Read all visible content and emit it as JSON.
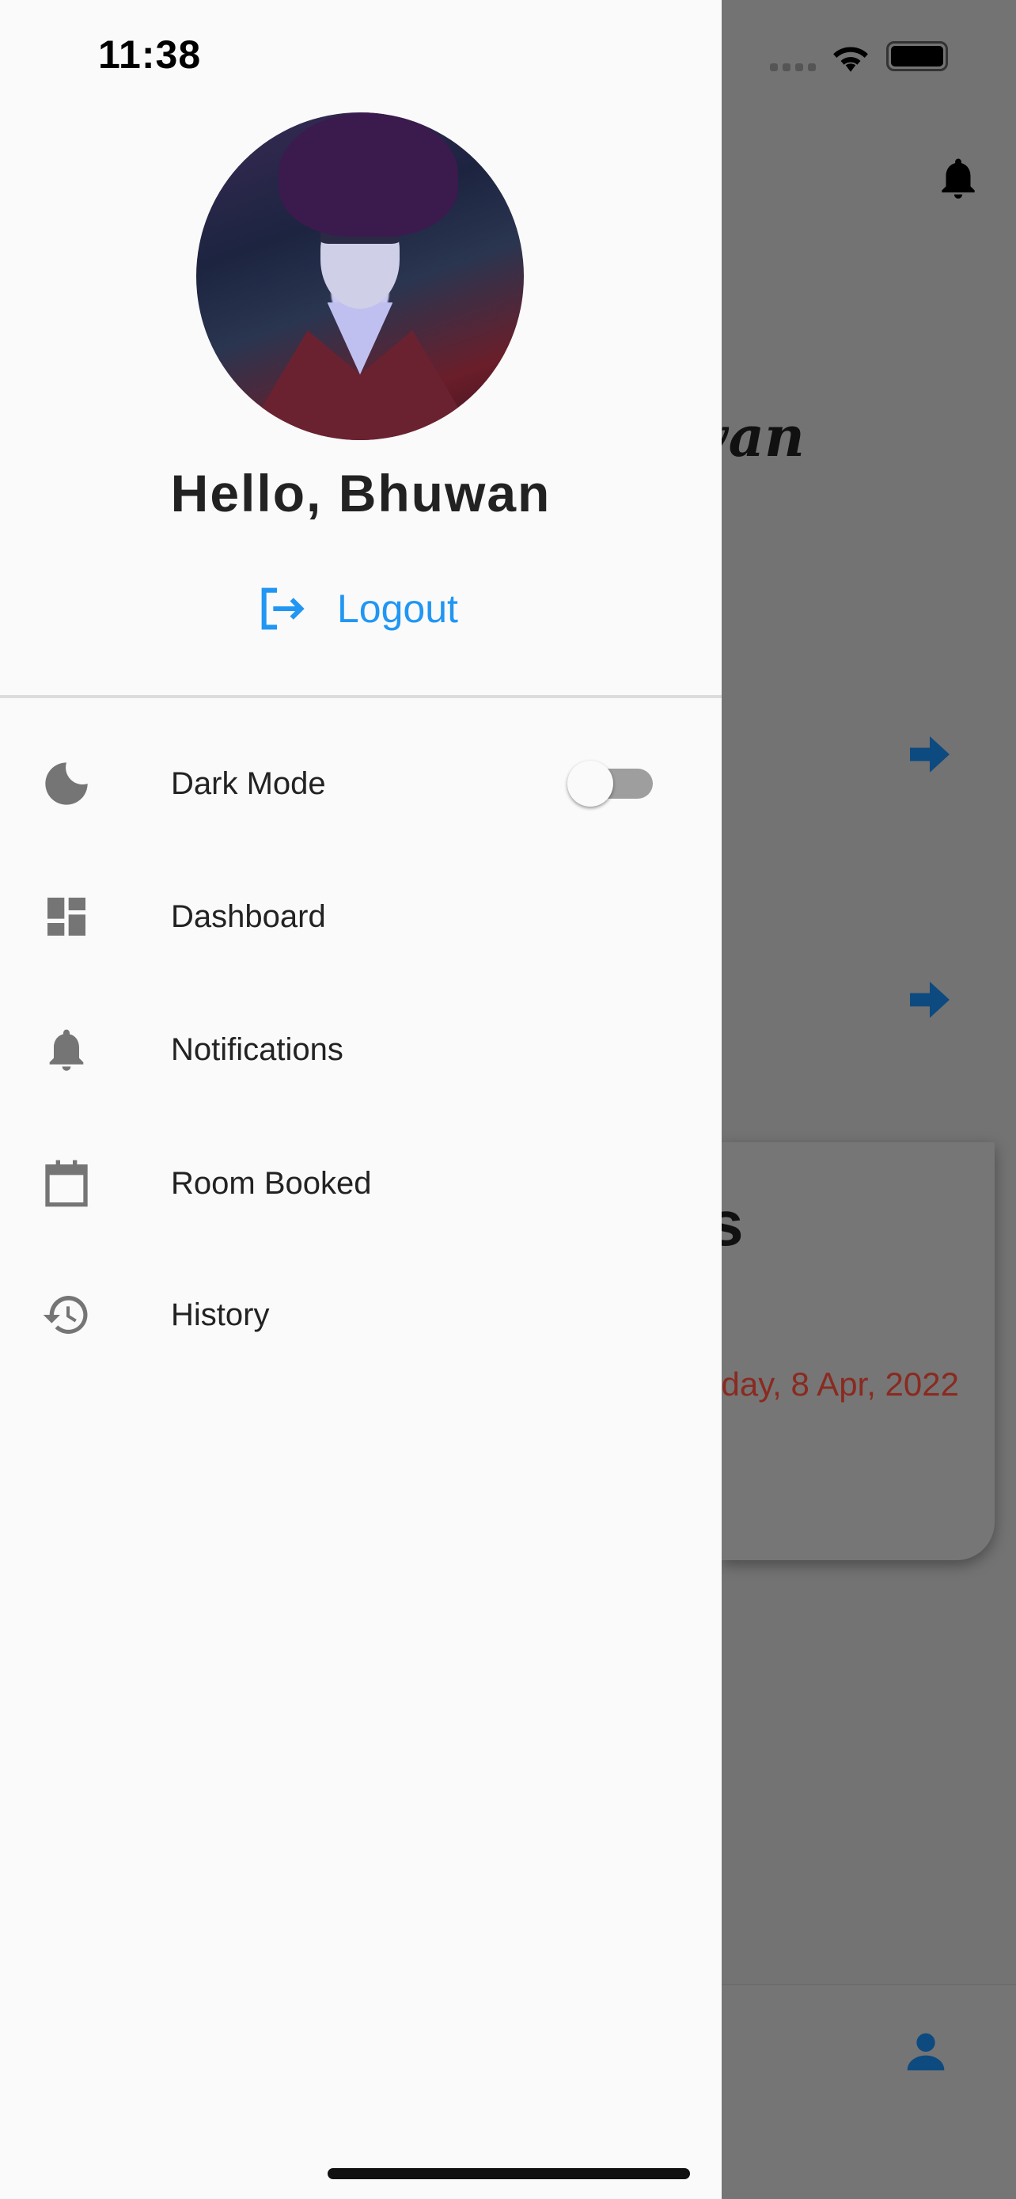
{
  "status_bar": {
    "time": "11:38",
    "icons": [
      "cellular-icon",
      "wifi-icon",
      "battery-icon"
    ]
  },
  "drawer": {
    "greeting": "Hello, Bhuwan",
    "logout_label": "Logout",
    "items": [
      {
        "label": "Dark Mode",
        "icon": "moon-icon",
        "toggle": false
      },
      {
        "label": "Dashboard",
        "icon": "dashboard-icon"
      },
      {
        "label": "Notifications",
        "icon": "bell-icon"
      },
      {
        "label": "Room Booked",
        "icon": "calendar-icon"
      },
      {
        "label": "History",
        "icon": "history-icon"
      }
    ]
  },
  "background": {
    "name_fragment": "van",
    "card_title_fragment": "s",
    "date_fragment": "iday, 8 Apr, 2022"
  },
  "colors": {
    "accent": "#2196f3",
    "overlay": "#737373",
    "date": "#8a2a20",
    "arrow": "#0d4a80"
  }
}
